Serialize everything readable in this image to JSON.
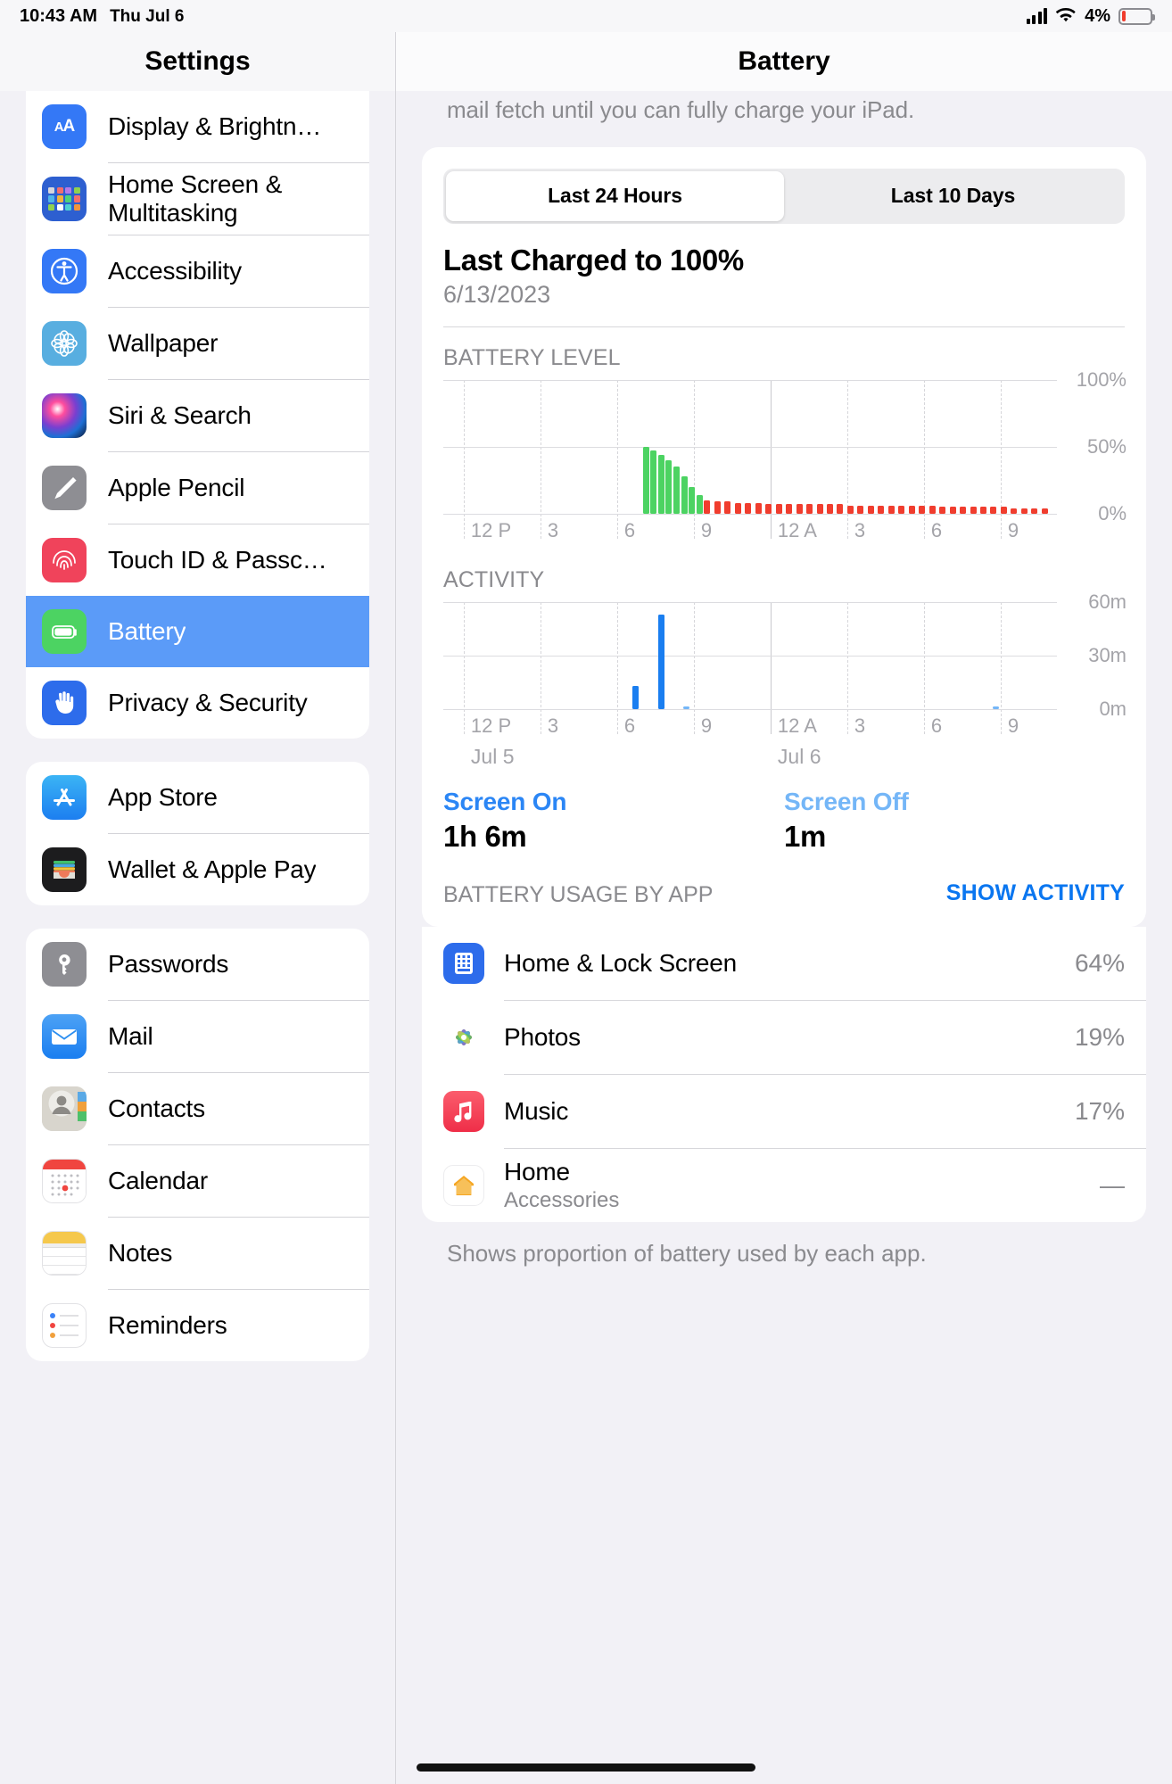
{
  "status_bar": {
    "time": "10:43 AM",
    "date": "Thu Jul 6",
    "battery_percent": "4%",
    "signal_icon": "cellular-bars-icon",
    "wifi_icon": "wifi-icon",
    "battery_icon": "battery-outline-icon"
  },
  "sidebar": {
    "title": "Settings",
    "groups": [
      {
        "items": [
          {
            "label": "Display & Brightn…",
            "icon": "display-brightness-icon",
            "selected": false
          },
          {
            "label": "Home Screen & Multitasking",
            "icon": "home-screen-icon",
            "selected": false,
            "wrap": true
          },
          {
            "label": "Accessibility",
            "icon": "accessibility-icon",
            "selected": false
          },
          {
            "label": "Wallpaper",
            "icon": "wallpaper-icon",
            "selected": false
          },
          {
            "label": "Siri & Search",
            "icon": "siri-icon",
            "selected": false
          },
          {
            "label": "Apple Pencil",
            "icon": "apple-pencil-icon",
            "selected": false
          },
          {
            "label": "Touch ID & Passc…",
            "icon": "touch-id-icon",
            "selected": false
          },
          {
            "label": "Battery",
            "icon": "battery-icon",
            "selected": true
          },
          {
            "label": "Privacy & Security",
            "icon": "privacy-security-icon",
            "selected": false
          }
        ]
      },
      {
        "items": [
          {
            "label": "App Store",
            "icon": "app-store-icon",
            "selected": false
          },
          {
            "label": "Wallet & Apple Pay",
            "icon": "wallet-icon",
            "selected": false
          }
        ]
      },
      {
        "items": [
          {
            "label": "Passwords",
            "icon": "passwords-key-icon",
            "selected": false
          },
          {
            "label": "Mail",
            "icon": "mail-icon",
            "selected": false
          },
          {
            "label": "Contacts",
            "icon": "contacts-icon",
            "selected": false
          },
          {
            "label": "Calendar",
            "icon": "calendar-icon",
            "selected": false
          },
          {
            "label": "Notes",
            "icon": "notes-icon",
            "selected": false
          },
          {
            "label": "Reminders",
            "icon": "reminders-icon",
            "selected": false
          }
        ]
      }
    ]
  },
  "detail": {
    "title": "Battery",
    "intro_text": "mail fetch until you can fully charge your iPad.",
    "segmented": {
      "options": [
        "Last 24 Hours",
        "Last 10 Days"
      ],
      "selected": "Last 24 Hours"
    },
    "last_charged_title": "Last Charged to 100%",
    "last_charged_date": "6/13/2023",
    "battery_level_label": "BATTERY LEVEL",
    "activity_label": "ACTIVITY",
    "screen_on_label": "Screen On",
    "screen_on_value": "1h 6m",
    "screen_off_label": "Screen Off",
    "screen_off_value": "1m",
    "usage_label": "BATTERY USAGE BY APP",
    "show_activity_label": "SHOW ACTIVITY",
    "footnote": "Shows proportion of battery used by each app.",
    "apps": [
      {
        "name": "Home & Lock Screen",
        "subtitle": "",
        "percent": "64%",
        "icon": "home-lock-screen-icon"
      },
      {
        "name": "Photos",
        "subtitle": "",
        "percent": "19%",
        "icon": "photos-icon"
      },
      {
        "name": "Music",
        "subtitle": "",
        "percent": "17%",
        "icon": "music-icon"
      },
      {
        "name": "Home",
        "subtitle": "Accessories",
        "percent": "—",
        "icon": "home-app-icon"
      }
    ]
  },
  "colors": {
    "accent_blue": "#0a76f0",
    "selection_blue": "#5b9bf8",
    "charging_green": "#4cd362",
    "drain_red": "#f03d2e",
    "activity_blue": "#1a7ef0",
    "screen_off_blue": "#74b6f7",
    "muted_gray": "#8a8a8e"
  },
  "chart_data": [
    {
      "type": "bar",
      "title": "BATTERY LEVEL",
      "ylabel": "",
      "xlabel": "",
      "ylim": [
        0,
        100
      ],
      "ytick_labels": [
        "100%",
        "50%",
        "0%"
      ],
      "ytick_values": [
        100,
        50,
        0
      ],
      "xtick_labels": [
        "12 P",
        "3",
        "6",
        "9",
        "12 A",
        "3",
        "6",
        "9"
      ],
      "xtick_hours": [
        12,
        15,
        18,
        21,
        24,
        27,
        30,
        33
      ],
      "grid": true,
      "legend": "none",
      "series": [
        {
          "name": "Charging",
          "color": "#4cd362",
          "points": [
            {
              "hour": 19.0,
              "value": 50
            },
            {
              "hour": 19.3,
              "value": 47
            },
            {
              "hour": 19.6,
              "value": 44
            },
            {
              "hour": 19.9,
              "value": 40
            },
            {
              "hour": 20.2,
              "value": 35
            },
            {
              "hour": 20.5,
              "value": 28
            },
            {
              "hour": 20.8,
              "value": 20
            },
            {
              "hour": 21.1,
              "value": 14
            }
          ]
        },
        {
          "name": "Battery Drain",
          "color": "#f03d2e",
          "points": [
            {
              "hour": 21.4,
              "value": 10
            },
            {
              "hour": 21.8,
              "value": 9
            },
            {
              "hour": 22.2,
              "value": 9
            },
            {
              "hour": 22.6,
              "value": 8
            },
            {
              "hour": 23.0,
              "value": 8
            },
            {
              "hour": 23.4,
              "value": 8
            },
            {
              "hour": 23.8,
              "value": 7
            },
            {
              "hour": 24.2,
              "value": 7
            },
            {
              "hour": 24.6,
              "value": 7
            },
            {
              "hour": 25.0,
              "value": 7
            },
            {
              "hour": 25.4,
              "value": 7
            },
            {
              "hour": 25.8,
              "value": 7
            },
            {
              "hour": 26.2,
              "value": 7
            },
            {
              "hour": 26.6,
              "value": 7
            },
            {
              "hour": 27.0,
              "value": 6
            },
            {
              "hour": 27.4,
              "value": 6
            },
            {
              "hour": 27.8,
              "value": 6
            },
            {
              "hour": 28.2,
              "value": 6
            },
            {
              "hour": 28.6,
              "value": 6
            },
            {
              "hour": 29.0,
              "value": 6
            },
            {
              "hour": 29.4,
              "value": 6
            },
            {
              "hour": 29.8,
              "value": 6
            },
            {
              "hour": 30.2,
              "value": 6
            },
            {
              "hour": 30.6,
              "value": 5
            },
            {
              "hour": 31.0,
              "value": 5
            },
            {
              "hour": 31.4,
              "value": 5
            },
            {
              "hour": 31.8,
              "value": 5
            },
            {
              "hour": 32.2,
              "value": 5
            },
            {
              "hour": 32.6,
              "value": 5
            },
            {
              "hour": 33.0,
              "value": 5
            },
            {
              "hour": 33.4,
              "value": 4
            },
            {
              "hour": 33.8,
              "value": 4
            },
            {
              "hour": 34.2,
              "value": 4
            },
            {
              "hour": 34.6,
              "value": 4
            }
          ]
        }
      ]
    },
    {
      "type": "bar",
      "title": "ACTIVITY",
      "ylabel": "",
      "xlabel": "",
      "ylim": [
        0,
        60
      ],
      "ytick_labels": [
        "60m",
        "30m",
        "0m"
      ],
      "ytick_values": [
        60,
        30,
        0
      ],
      "xtick_labels": [
        "12 P",
        "3",
        "6",
        "9",
        "12 A",
        "3",
        "6",
        "9"
      ],
      "xtick_hours": [
        12,
        15,
        18,
        21,
        24,
        27,
        30,
        33
      ],
      "day_labels": [
        "Jul 5",
        "Jul 6"
      ],
      "day_label_hours": [
        12,
        24
      ],
      "grid": true,
      "legend": "none",
      "series": [
        {
          "name": "Screen On",
          "color": "#1a7ef0",
          "points": [
            {
              "hour": 18.6,
              "value": 13
            },
            {
              "hour": 19.6,
              "value": 53
            }
          ]
        },
        {
          "name": "Screen Off",
          "color": "#74b6f7",
          "points": [
            {
              "hour": 20.6,
              "value": 1.5
            },
            {
              "hour": 32.7,
              "value": 1.5
            }
          ]
        }
      ]
    }
  ]
}
